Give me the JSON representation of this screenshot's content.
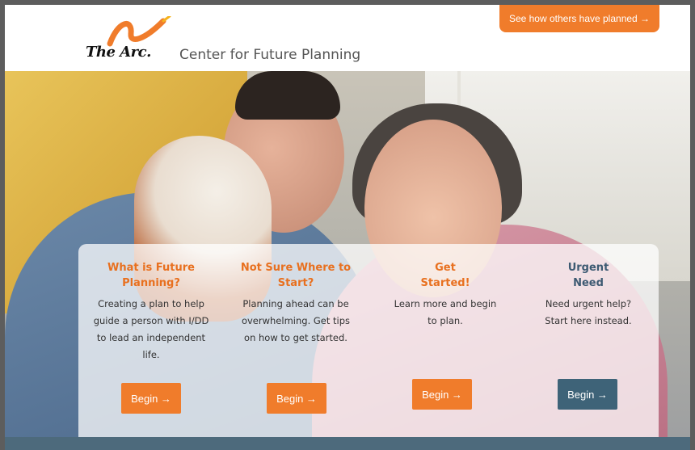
{
  "header": {
    "logo_text": "The Arc.",
    "site_title": "Center for Future Planning",
    "cta_label": "See how others have planned →"
  },
  "colors": {
    "accent_orange": "#f07c2b",
    "accent_blue": "#3e6378",
    "bottom_bar": "#4d6a7c"
  },
  "sections": [
    {
      "title_line1": "What is Future",
      "title_line2": "Planning?",
      "description": "Creating a plan to help guide a person with I/DD to lead an independent life.",
      "button_label": "Begin →"
    },
    {
      "title_line1": "Not Sure Where to",
      "title_line2": "Start?",
      "description": "Planning ahead can be overwhelming. Get tips on how to get started.",
      "button_label": "Begin →"
    },
    {
      "title_line1": "Get",
      "title_line2": "Started!",
      "description": "Learn more and begin to plan.",
      "button_label": "Begin →"
    },
    {
      "title_line1": "Urgent",
      "title_line2": "Need",
      "description": "Need urgent help? Start here instead.",
      "button_label": "Begin →"
    }
  ]
}
